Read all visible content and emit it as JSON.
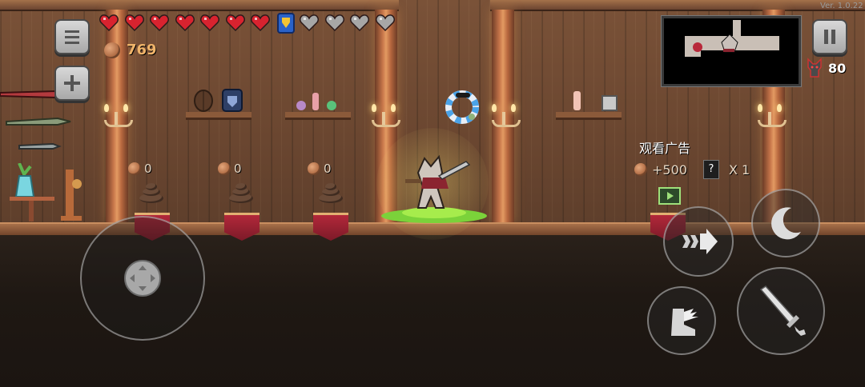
{
  "version_text": "Ver. 1.0.22",
  "hud": {
    "hearts_full": 7,
    "hearts_empty": 4,
    "coins": "769",
    "enemy_count": "80"
  },
  "shop": {
    "slots": [
      {
        "price": "0",
        "item": "poop"
      },
      {
        "price": "0",
        "item": "poop"
      },
      {
        "price": "0",
        "item": "poop"
      }
    ],
    "ad": {
      "title": "观看广告",
      "reward_coins": "+500",
      "reward_mystery": "X 1",
      "mystery_glyph": "?"
    }
  },
  "colors": {
    "heart_red": "#d8232f",
    "heart_empty": "#a7a7a7",
    "coin_text": "#f0b46a",
    "shield_blue": "#2a62c9",
    "shield_gold": "#f3c434"
  },
  "controls": {
    "menu_icon": "menu-icon",
    "add_icon": "plus-icon",
    "pause_icon": "pause-icon",
    "dash_icon": "dash-arrow-icon",
    "special_icon": "crescent-icon",
    "jump_icon": "winged-boot-icon",
    "attack_icon": "sword-icon",
    "joystick_icon": "dpad-icon"
  }
}
